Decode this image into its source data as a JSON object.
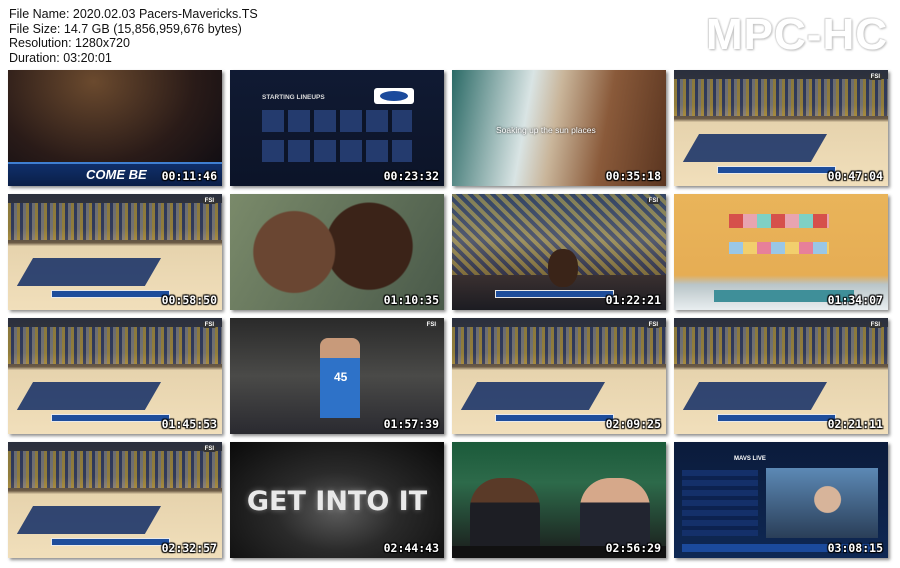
{
  "app": {
    "logo_text": "MPC-HC"
  },
  "file_info": {
    "file_name": "File Name: 2020.02.03 Pacers-Mavericks.TS",
    "file_size": "File Size: 14.7 GB (15,856,959,676 bytes)",
    "resolution": "Resolution: 1280x720",
    "duration": "Duration: 03:20:01"
  },
  "thumbnails": [
    {
      "time": "00:11:46",
      "scene": "arena",
      "overlay_text": "COME BE"
    },
    {
      "time": "00:23:32",
      "scene": "lineup",
      "overlay_text": "STARTING LINEUPS"
    },
    {
      "time": "00:35:18",
      "scene": "beach",
      "overlay_text": "Soaking up the sun places"
    },
    {
      "time": "00:47:04",
      "scene": "court"
    },
    {
      "time": "00:58:50",
      "scene": "court"
    },
    {
      "time": "01:10:35",
      "scene": "mom"
    },
    {
      "time": "01:22:21",
      "scene": "crowd"
    },
    {
      "time": "01:34:07",
      "scene": "store"
    },
    {
      "time": "01:45:53",
      "scene": "court"
    },
    {
      "time": "01:57:39",
      "scene": "bench",
      "overlay_text": "45"
    },
    {
      "time": "02:09:25",
      "scene": "court"
    },
    {
      "time": "02:21:11",
      "scene": "court"
    },
    {
      "time": "02:32:57",
      "scene": "court"
    },
    {
      "time": "02:44:43",
      "scene": "getinto",
      "overlay_text": "GET INTO IT"
    },
    {
      "time": "02:56:29",
      "scene": "studio"
    },
    {
      "time": "03:08:15",
      "scene": "mavslive",
      "overlay_text": "MAVS LIVE"
    }
  ]
}
